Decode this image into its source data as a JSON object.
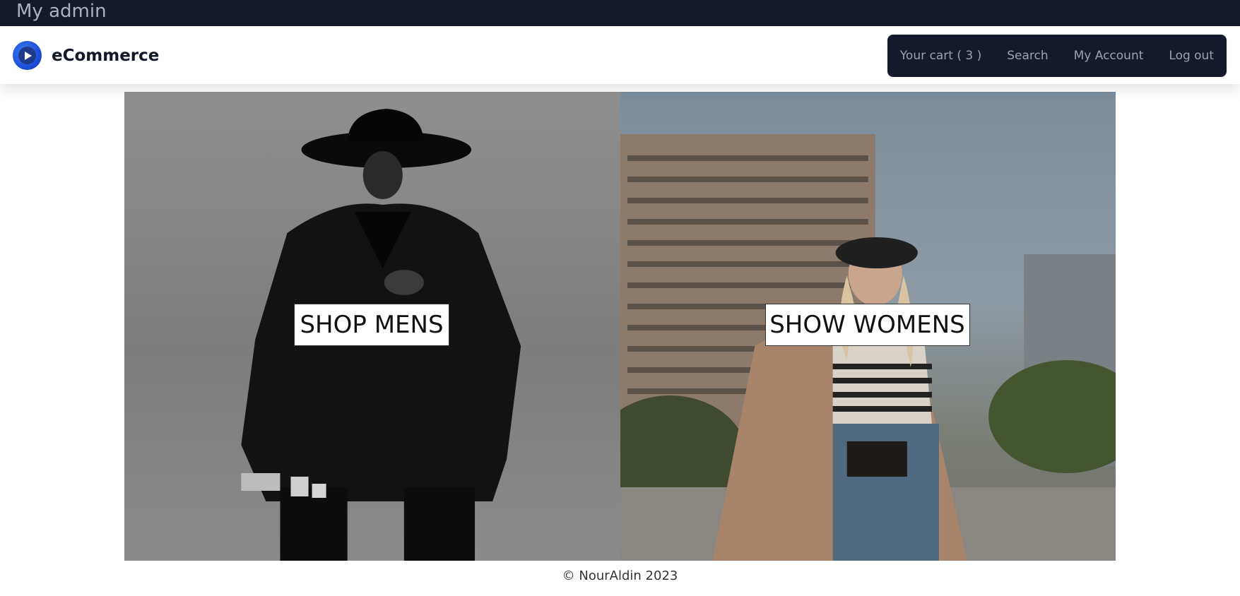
{
  "admin_bar": {
    "title": "My admin"
  },
  "navbar": {
    "brand": "eCommerce",
    "menu": [
      {
        "label": "Your cart ( 3 )"
      },
      {
        "label": "Search"
      },
      {
        "label": "My Account"
      },
      {
        "label": "Log out"
      }
    ]
  },
  "hero": {
    "men_button": "SHOP MENS",
    "women_button": "SHOW WOMENS"
  },
  "footer": {
    "text": "© NourAldin 2023"
  },
  "icons": {
    "brand_logo": "play-logo-icon"
  },
  "colors": {
    "admin_bar": "#141a2b",
    "menu_bg": "#141a2b",
    "menu_text": "#9ca3af",
    "brand_blue": "#1d4ed8"
  }
}
